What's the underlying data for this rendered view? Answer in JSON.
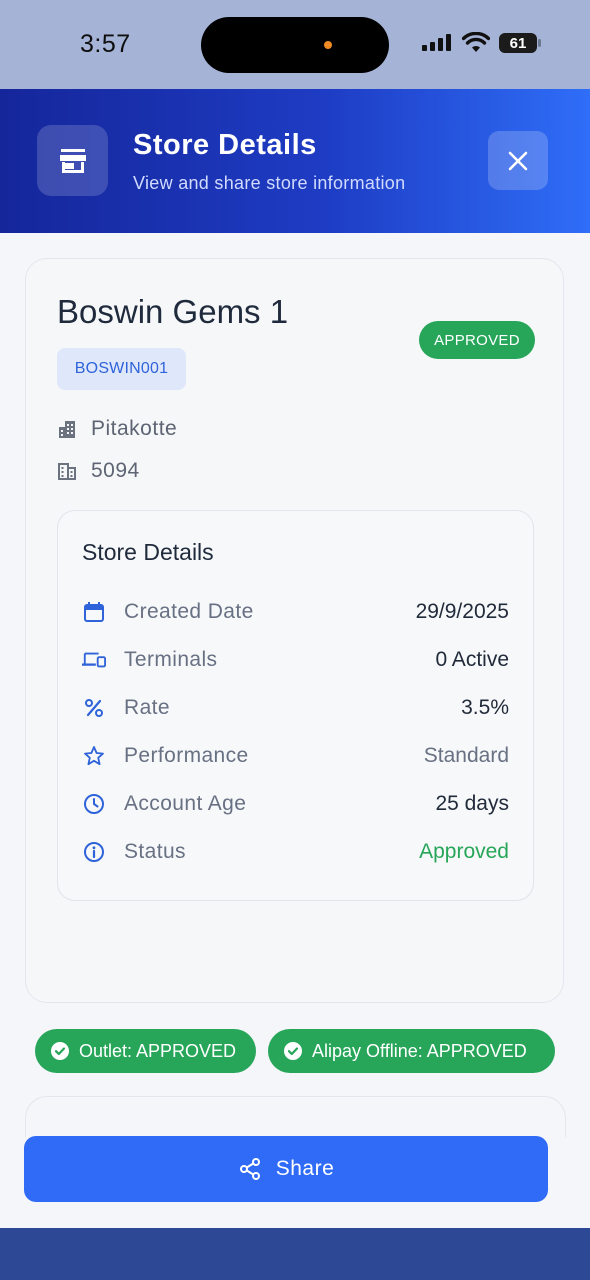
{
  "status_bar": {
    "time": "3:57",
    "battery": "61"
  },
  "header": {
    "title": "Store Details",
    "subtitle": "View and share store information",
    "icon": "store-icon",
    "close_icon": "close-icon"
  },
  "store": {
    "name": "Boswin Gems 1",
    "status_badge": "APPROVED",
    "code": "BOSWIN001",
    "city": "Pitakotte",
    "postal": "5094"
  },
  "details": {
    "title": "Store Details",
    "rows": [
      {
        "icon": "calendar-icon",
        "label": "Created Date",
        "value": "29/9/2025",
        "color": "#222b3b"
      },
      {
        "icon": "devices-icon",
        "label": "Terminals",
        "value": "0 Active",
        "color": "#222b3b"
      },
      {
        "icon": "percent-icon",
        "label": "Rate",
        "value": "3.5%",
        "color": "#222b3b"
      },
      {
        "icon": "star-icon",
        "label": "Performance",
        "value": "Standard",
        "color": "#687083"
      },
      {
        "icon": "clock-icon",
        "label": "Account Age",
        "value": "25 days",
        "color": "#222b3b"
      },
      {
        "icon": "info-icon",
        "label": "Status",
        "value": "Approved",
        "color": "#27a65a"
      }
    ]
  },
  "chips": [
    {
      "label": "Outlet: APPROVED"
    },
    {
      "label": "Alipay Offline: APPROVED"
    }
  ],
  "share_button": {
    "label": "Share"
  },
  "colors": {
    "accent": "#2f6bf6",
    "success": "#27a65a",
    "header_start": "#15269a",
    "header_end": "#2f6ef8"
  }
}
